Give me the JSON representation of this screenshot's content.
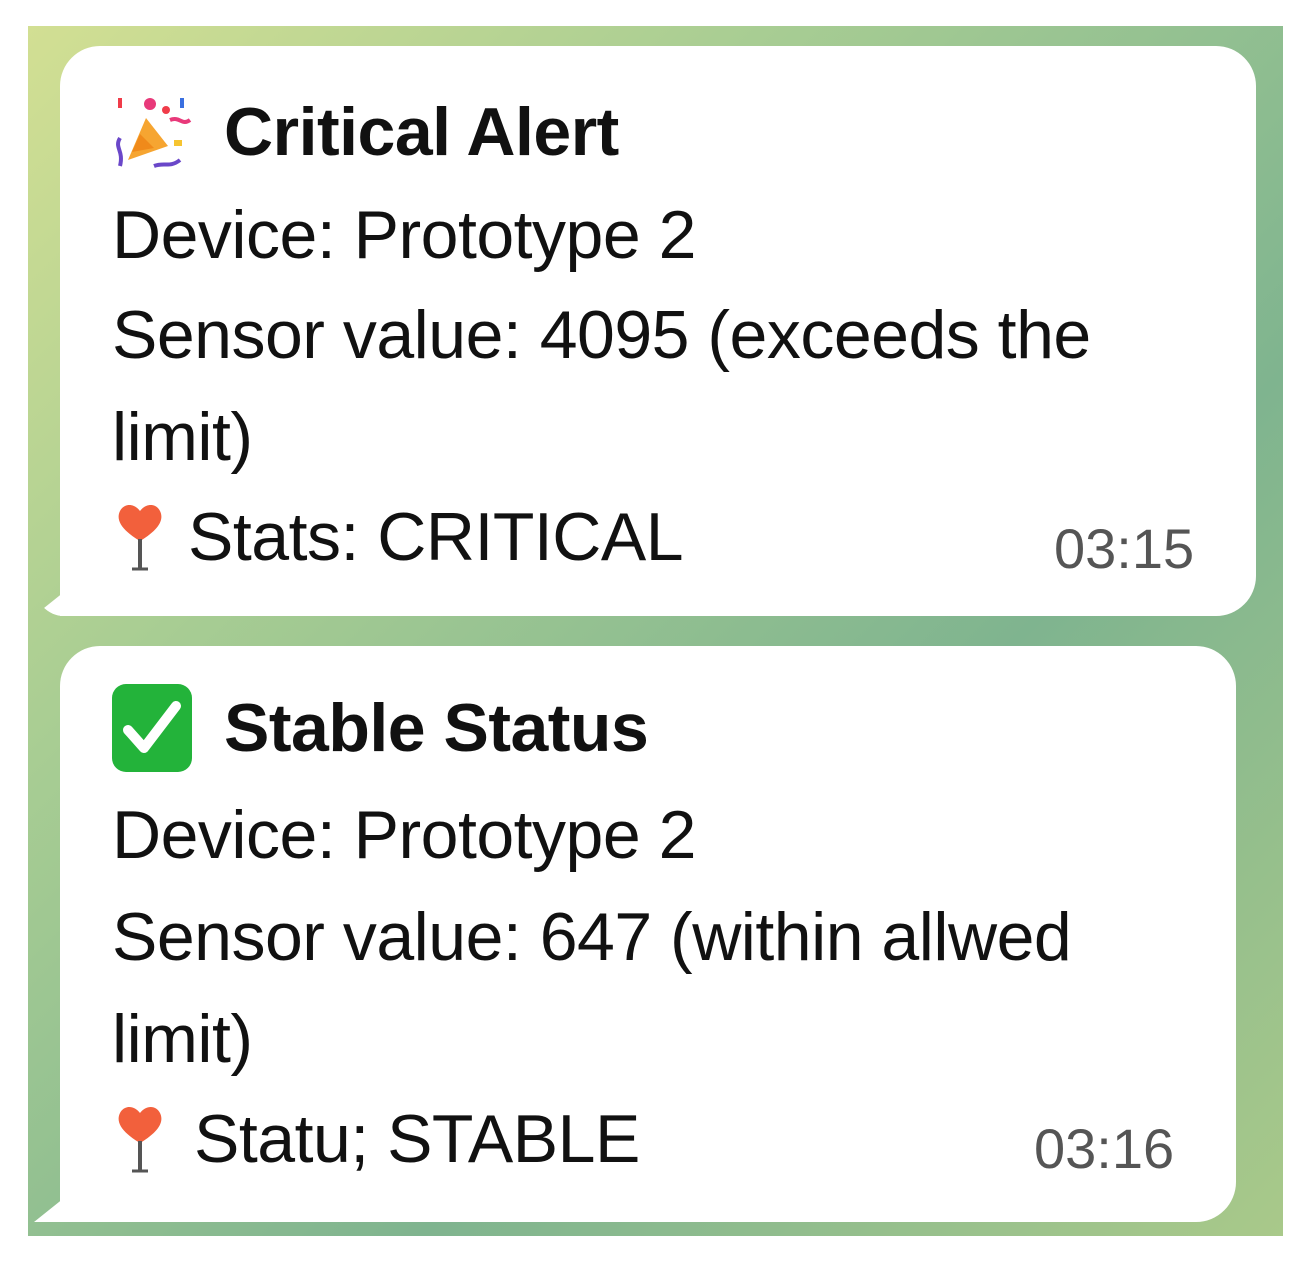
{
  "messages": [
    {
      "title": "Critical Alert",
      "title_icon": "party-popper-icon",
      "device": "Device: Prototype 2",
      "sensor_line1": "Sensor value: 4095 (exceeds the",
      "sensor_line2": "limit)",
      "status_icon": "pin-icon",
      "status": "Stats: CRITICAL",
      "time": "03:15"
    },
    {
      "title": "Stable Status",
      "title_icon": "check-mark-icon",
      "device": "Device: Prototype 2",
      "sensor_line1": "Sensor value: 647  (within allwed",
      "sensor_line2": "limit)",
      "status_icon": "pin-icon",
      "status": "Statu; STABLE",
      "time": "03:16"
    }
  ],
  "colors": {
    "check_green": "#23b33a",
    "pin_red": "#f2603c",
    "bubble": "#ffffff"
  }
}
